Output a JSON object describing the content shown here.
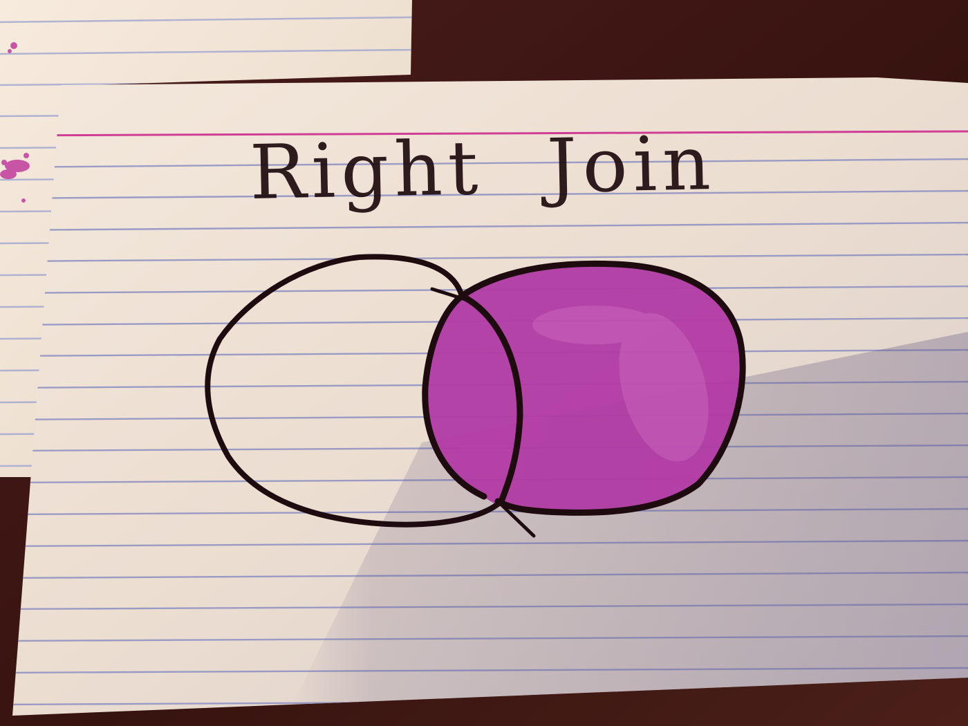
{
  "title": {
    "word_1": "Right",
    "word_2": "Join"
  },
  "colors": {
    "desk": "#3a1716",
    "card": "#f1e4d7",
    "rule_line": "#8e90c2",
    "margin_line": "#cc2f8e",
    "ink": "#1e0b0f",
    "highlight": "#b13aa4"
  }
}
